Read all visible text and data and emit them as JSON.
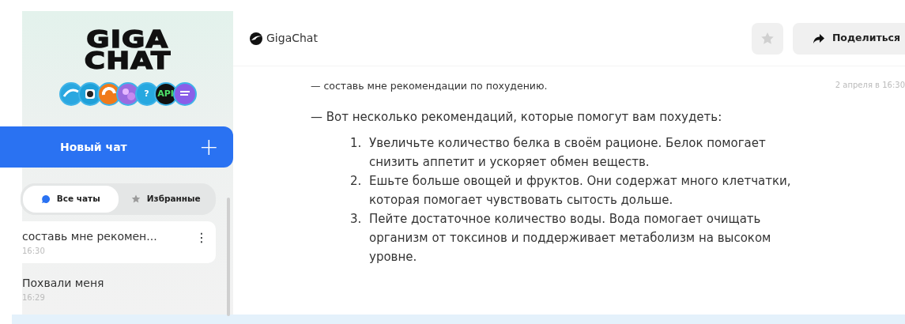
{
  "sidebar": {
    "logo": [
      "GIGA",
      "CHAT"
    ],
    "badges": [
      {
        "kind": "wave",
        "color": "#2aa7e0"
      },
      {
        "kind": "camera",
        "color": "#1fa0d8"
      },
      {
        "kind": "swirl",
        "color": "#f07a1a"
      },
      {
        "kind": "bubbles",
        "color": "#9a6be0"
      },
      {
        "kind": "glyph",
        "color": "#27a8e0",
        "label": "?"
      },
      {
        "kind": "glyph",
        "color": "#111111",
        "label": "API"
      },
      {
        "kind": "plain",
        "color": "#8a5ee8"
      }
    ],
    "new_chat": {
      "label": "Новый чат",
      "icon": "+"
    },
    "tabs": [
      {
        "label": "Все чаты",
        "kind": "bubble",
        "selected": true
      },
      {
        "label": "Избранные",
        "kind": "star",
        "selected": false
      }
    ],
    "chats": [
      {
        "title": "составь мне рекомен...",
        "time": "16:30",
        "selected": true,
        "menu": "⋮"
      },
      {
        "title": "Похвали меня",
        "time": "16:29",
        "selected": false
      }
    ]
  },
  "header": {
    "title": "GigaChat",
    "favorite": false,
    "share": "Поделиться"
  },
  "messages": [
    {
      "kind": "question",
      "text": "— составь мне рекомендации по похудению.",
      "time": "2 апреля в 16:30"
    },
    {
      "kind": "answer",
      "text": "— Вот несколько рекомендаций, которые помогут вам похудеть:",
      "items": [
        {
          "number": "1.",
          "lines": [
            "Увеличьте количество белка в своём рационе. Белок помогает",
            "снизить аппетит и ускоряет обмен веществ."
          ]
        },
        {
          "number": "2.",
          "lines": [
            "Ешьте больше овощей и фруктов. Они содержат много клетчатки,",
            "которая помогает чувствовать сытость дольше."
          ]
        },
        {
          "number": "3.",
          "lines": [
            "Пейте достаточное количество воды. Вода помогает очищать",
            "организм от токсинов и поддерживает метаболизм на высоком",
            "уровне."
          ]
        }
      ]
    }
  ]
}
